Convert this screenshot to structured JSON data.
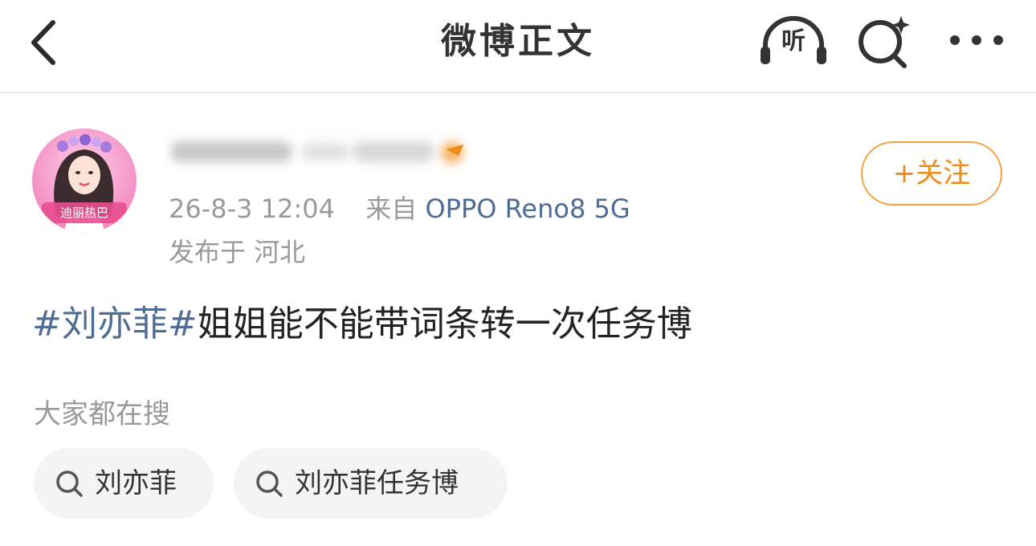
{
  "header": {
    "title": "微博正文",
    "listen_label": "听"
  },
  "post": {
    "author": {
      "name": ""
    },
    "timestamp": "26-8-3 12:04",
    "source_prefix": "来自",
    "source": "OPPO Reno8 5G",
    "location": "发布于 河北",
    "follow_label": "+关注",
    "hashtag": "#刘亦菲#",
    "text": "姐姐能不能带词条转一次任务博"
  },
  "searches": {
    "title": "大家都在搜",
    "items": [
      {
        "label": "刘亦菲"
      },
      {
        "label": "刘亦菲任务博"
      }
    ]
  },
  "colors": {
    "link": "#4f6c95",
    "accent": "#f08b1a",
    "muted": "#9a9a9a"
  }
}
